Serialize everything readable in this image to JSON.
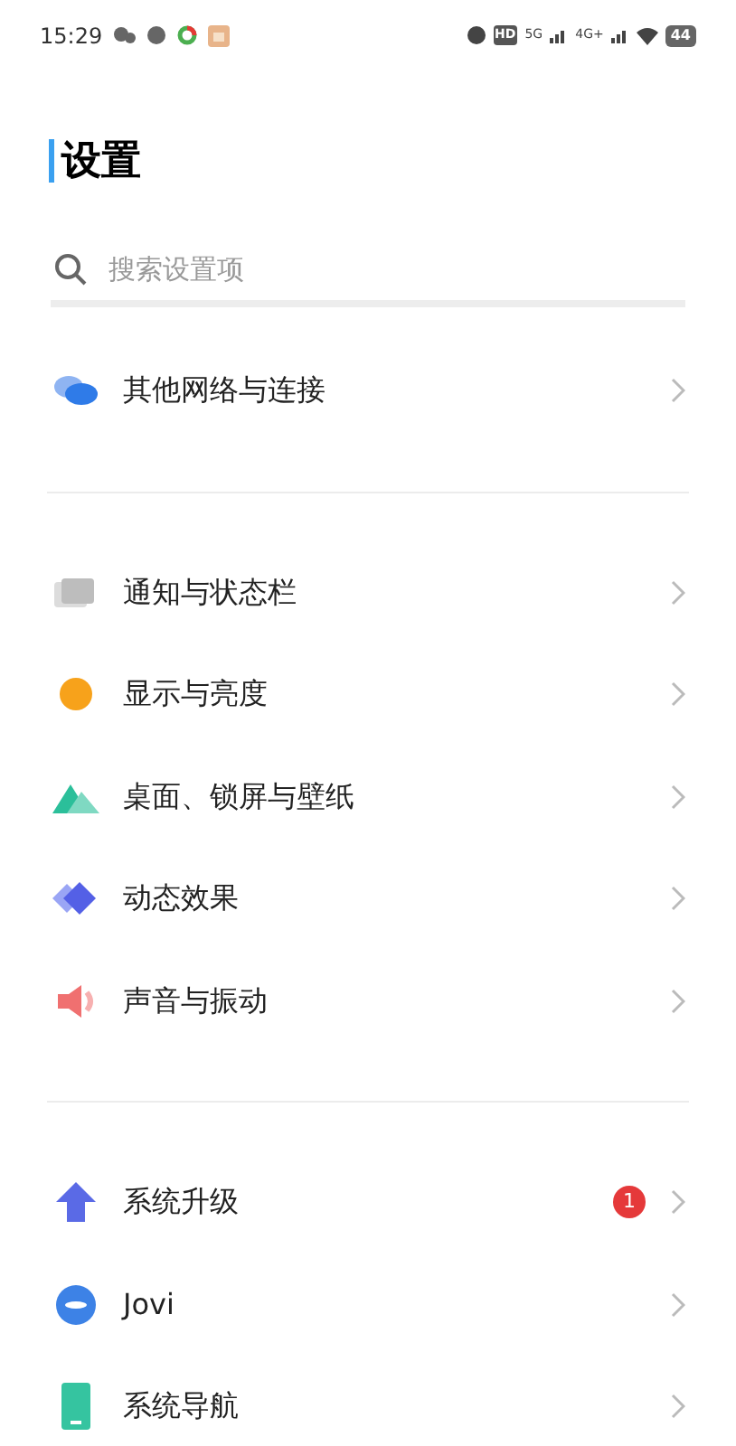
{
  "status_bar": {
    "time": "15:29",
    "hd": "HD",
    "net_1": "5G",
    "net_2": "4G+",
    "battery": "44"
  },
  "title": "设置",
  "search": {
    "placeholder": "搜索设置项"
  },
  "sections": [
    {
      "items": [
        {
          "kind": "network",
          "label": "其他网络与连接"
        }
      ]
    },
    {
      "items": [
        {
          "kind": "notify",
          "label": "通知与状态栏"
        },
        {
          "kind": "display",
          "label": "显示与亮度"
        },
        {
          "kind": "wallpaper",
          "label": "桌面、锁屏与壁纸"
        },
        {
          "kind": "effects",
          "label": "动态效果"
        },
        {
          "kind": "sound",
          "label": "声音与振动"
        }
      ]
    },
    {
      "items": [
        {
          "kind": "upgrade",
          "label": "系统升级",
          "badge": "1"
        },
        {
          "kind": "jovi",
          "label": "Jovi"
        },
        {
          "kind": "navigation",
          "label": "系统导航"
        }
      ]
    }
  ]
}
